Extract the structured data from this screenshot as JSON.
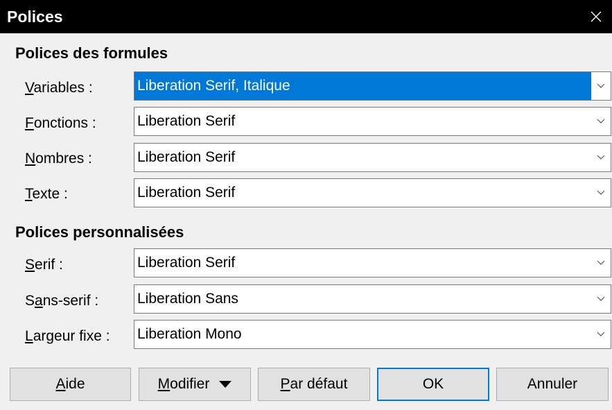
{
  "window": {
    "title": "Polices"
  },
  "formula_fonts": {
    "heading": "Polices des formules",
    "rows": [
      {
        "underline": "V",
        "rest": "ariables :",
        "value": "Liberation Serif, Italique",
        "selected": true
      },
      {
        "underline": "F",
        "rest": "onctions :",
        "value": "Liberation Serif",
        "selected": false
      },
      {
        "underline": "N",
        "rest": "ombres :",
        "value": "Liberation Serif",
        "selected": false
      },
      {
        "underline": "T",
        "rest": "exte :",
        "value": "Liberation Serif",
        "selected": false
      }
    ]
  },
  "custom_fonts": {
    "heading": "Polices personnalisées",
    "rows": [
      {
        "prefix": "",
        "underline": "S",
        "rest": "erif :",
        "value": "Liberation Serif"
      },
      {
        "prefix": "S",
        "underline": "a",
        "rest": "ns-serif :",
        "value": "Liberation Sans"
      },
      {
        "prefix": "",
        "underline": "L",
        "rest": "argeur fixe :",
        "value": "Liberation Mono"
      }
    ]
  },
  "buttons": {
    "help": {
      "underline": "A",
      "rest": "ide"
    },
    "modify": {
      "underline": "M",
      "rest": "odifier"
    },
    "default": {
      "underline": "P",
      "rest": "ar défaut"
    },
    "ok": "OK",
    "cancel": "Annuler"
  },
  "colors": {
    "selection": "#0078d7",
    "titlebar": "#000000"
  }
}
